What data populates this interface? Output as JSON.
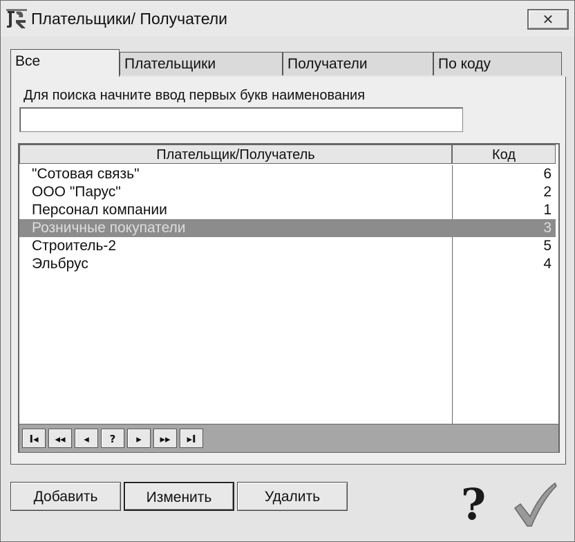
{
  "window": {
    "title": "Плательщики/ Получатели",
    "close_label": "✕"
  },
  "tabs": [
    {
      "label": "Все"
    },
    {
      "label": "Плательщики"
    },
    {
      "label": "Получатели"
    },
    {
      "label": "По коду"
    }
  ],
  "search": {
    "label": "Для поиска начните ввод первых букв наименования",
    "value": ""
  },
  "grid": {
    "columns": [
      "Плательщик/Получатель",
      "Код"
    ],
    "rows": [
      {
        "name": "\"Сотовая связь\"",
        "code": "6"
      },
      {
        "name": "ООО \"Парус\"",
        "code": "2"
      },
      {
        "name": "Персонал компании",
        "code": "1"
      },
      {
        "name": "Розничные покупатели",
        "code": "3"
      },
      {
        "name": "Строитель-2",
        "code": "5"
      },
      {
        "name": "Эльбрус",
        "code": "4"
      }
    ],
    "selected_row": 3
  },
  "navigator": {
    "buttons": [
      {
        "label": "I◂"
      },
      {
        "label": "◂◂"
      },
      {
        "label": "◂"
      },
      {
        "label": "?"
      },
      {
        "label": "▸"
      },
      {
        "label": "▸▸"
      },
      {
        "label": "▸I"
      }
    ]
  },
  "buttons": {
    "add": "Добавить",
    "edit": "Изменить",
    "delete": "Удалить"
  },
  "icons": {
    "help": "?",
    "ok": "checkmark-icon"
  }
}
